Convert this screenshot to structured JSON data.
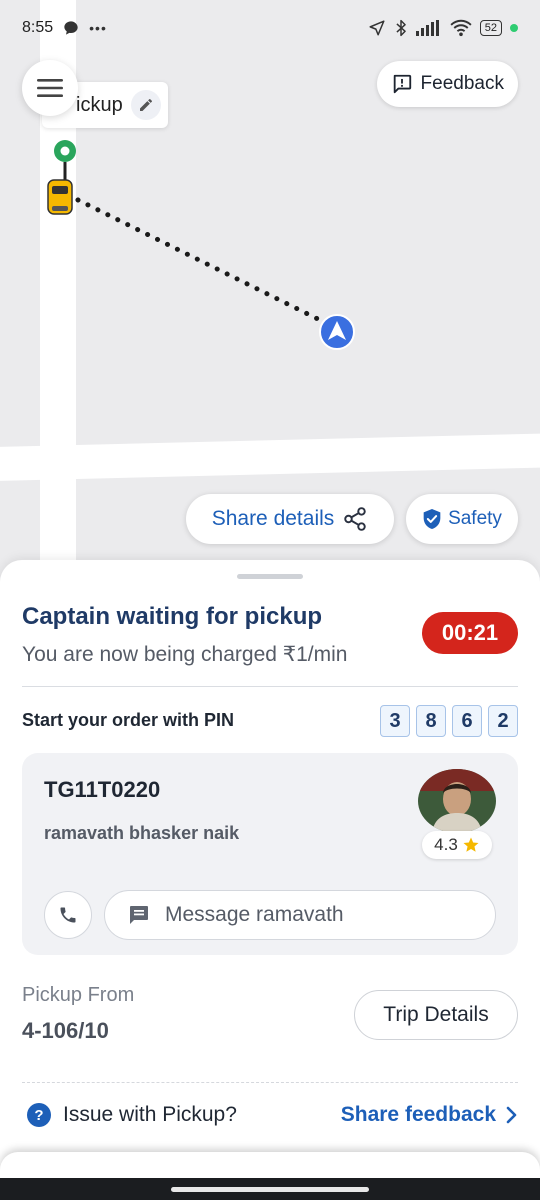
{
  "status_bar": {
    "time": "8:55",
    "dots": "•••",
    "battery": "52"
  },
  "map": {
    "pickup_label": "ickup",
    "feedback_label": "Feedback",
    "share_details_label": "Share details",
    "safety_label": "Safety"
  },
  "ride": {
    "status_title": "Captain waiting for pickup",
    "status_sub": "You are now being charged ₹1/min",
    "timer": "00:21",
    "pin_label": "Start your order with PIN",
    "pin_digits": [
      "3",
      "8",
      "6",
      "2"
    ]
  },
  "driver": {
    "plate": "TG11T0220",
    "name": "ramavath bhasker  naik",
    "rating": "4.3",
    "message_placeholder": "Message ramavath"
  },
  "pickup": {
    "label": "Pickup From",
    "address": "4-106/10",
    "trip_details_label": "Trip Details"
  },
  "issue": {
    "question": "Issue with Pickup?",
    "share_feedback_label": "Share feedback"
  },
  "colors": {
    "accent": "#1d5fb8",
    "timer_bg": "#d4251c",
    "pickup_marker": "#2aa55c",
    "vehicle": "#f5b800",
    "destination_marker": "#3a6fe0"
  }
}
